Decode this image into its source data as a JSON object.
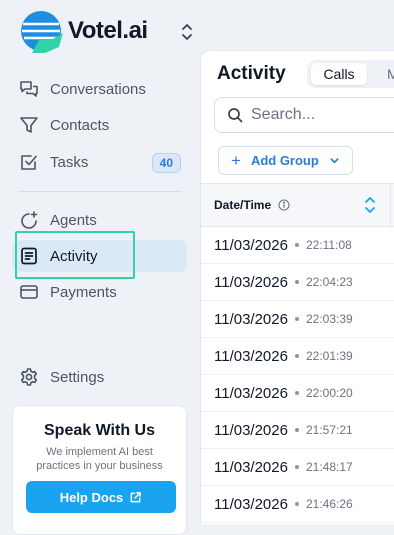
{
  "brand": {
    "name": "Votel.ai"
  },
  "sidebar": {
    "items": [
      {
        "label": "Conversations",
        "icon": "conversations-icon"
      },
      {
        "label": "Contacts",
        "icon": "filter-icon"
      },
      {
        "label": "Tasks",
        "icon": "checkbox-icon",
        "badge": "40"
      },
      {
        "label": "Agents",
        "icon": "sparkle-agent-icon"
      },
      {
        "label": "Activity",
        "icon": "activity-list-icon",
        "active": true
      },
      {
        "label": "Payments",
        "icon": "credit-card-icon"
      },
      {
        "label": "Settings",
        "icon": "gear-icon"
      }
    ]
  },
  "promo": {
    "title": "Speak With Us",
    "text": "We implement AI best practices in your business",
    "button": "Help Docs"
  },
  "main": {
    "title": "Activity",
    "tabs": [
      {
        "label": "Calls",
        "active": true
      },
      {
        "label": "M"
      }
    ],
    "search_placeholder": "Search...",
    "add_group": "Add Group",
    "column_header": "Date/Time",
    "rows": [
      {
        "date": "11/03/2026",
        "time": "22:11:08"
      },
      {
        "date": "11/03/2026",
        "time": "22:04:23"
      },
      {
        "date": "11/03/2026",
        "time": "22:03:39"
      },
      {
        "date": "11/03/2026",
        "time": "22:01:39"
      },
      {
        "date": "11/03/2026",
        "time": "22:00:20"
      },
      {
        "date": "11/03/2026",
        "time": "21:57:21"
      },
      {
        "date": "11/03/2026",
        "time": "21:48:17"
      },
      {
        "date": "11/03/2026",
        "time": "21:46:26"
      }
    ]
  },
  "colors": {
    "accent": "#1aa3ef",
    "active_bg": "#dbe8f8",
    "focus": "#2fd3a6",
    "badge_text": "#2b7bd8"
  }
}
